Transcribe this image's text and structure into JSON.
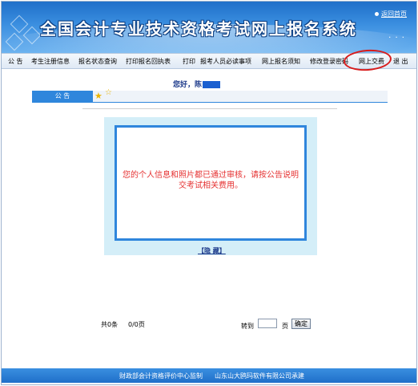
{
  "header": {
    "title": "全国会计专业技术资格考试网上报名系统",
    "home_link": "返回首页",
    "dots": "· · ·"
  },
  "nav": {
    "items": [
      {
        "label": "公 告"
      },
      {
        "label": "考生注册信息"
      },
      {
        "label": "报名状态查询"
      },
      {
        "label": "打印报名回执表"
      },
      {
        "label": "打印"
      },
      {
        "label": "报考人员必读事项"
      },
      {
        "label": "网上报名须知"
      },
      {
        "label": "修改登录密码"
      },
      {
        "label": "网上交费"
      },
      {
        "label": "退 出"
      }
    ]
  },
  "main": {
    "greeting": "您好，陈",
    "notice_tab": "公 告",
    "message": "您的个人信息和照片都已通过审核，请按公告说明交考试相关费用。",
    "hide_link": "【隐 藏】",
    "paging": {
      "total": "共0条",
      "pages": "0/0页",
      "goto": "转到",
      "page_unit": "页",
      "confirm": "确定",
      "page_value": ""
    }
  },
  "footer": {
    "supervisor": "财政部会计资格评价中心监制",
    "developer": "山东山大鸥玛软件有限公司承建"
  },
  "colors": {
    "banner_blue": "#1f6fc9",
    "accent_blue": "#2f86dc",
    "message_red": "#e53030",
    "annotation_red": "#d81b1b"
  }
}
